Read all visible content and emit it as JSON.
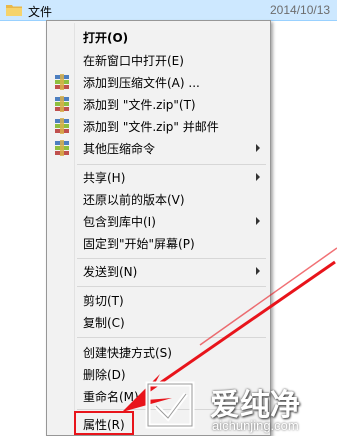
{
  "explorer": {
    "folder_name": "文件",
    "date": "2014/10/13"
  },
  "menu": {
    "items": [
      {
        "label": "打开(O)"
      },
      {
        "label": "在新窗口中打开(E)"
      },
      {
        "label": "添加到压缩文件(A) ..."
      },
      {
        "label": "添加到 \"文件.zip\"(T)"
      },
      {
        "label": "添加到 \"文件.zip\" 并邮件"
      },
      {
        "label": "其他压缩命令"
      },
      {
        "label": "共享(H)"
      },
      {
        "label": "还原以前的版本(V)"
      },
      {
        "label": "包含到库中(I)"
      },
      {
        "label": "固定到\"开始\"屏幕(P)"
      },
      {
        "label": "发送到(N)"
      },
      {
        "label": "剪切(T)"
      },
      {
        "label": "复制(C)"
      },
      {
        "label": "创建快捷方式(S)"
      },
      {
        "label": "删除(D)"
      },
      {
        "label": "重命名(M)"
      },
      {
        "label": "属性(R)"
      }
    ]
  },
  "watermark": {
    "title": "爱纯净",
    "url": "aichunjing.com"
  },
  "colors": {
    "selection": "#cde8ff",
    "highlight": "#e8141b",
    "menu_bg": "#f2f2f2"
  }
}
